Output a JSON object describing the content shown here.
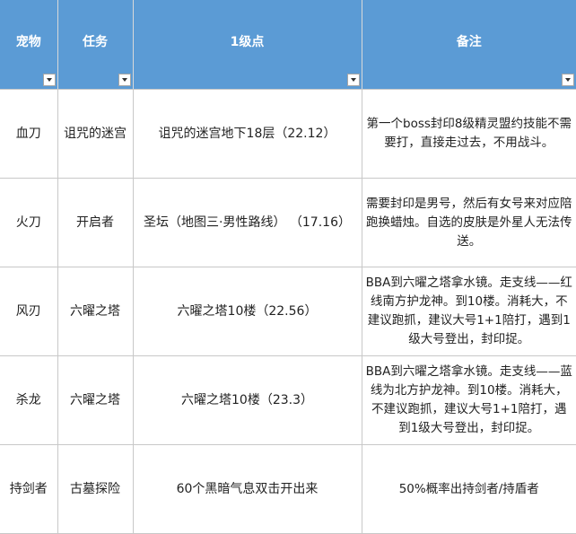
{
  "columns": [
    {
      "label": "宠物"
    },
    {
      "label": "任务"
    },
    {
      "label": "1级点"
    },
    {
      "label": "备注"
    }
  ],
  "rows": [
    {
      "pet": "血刀",
      "quest": "诅咒的迷宫",
      "spot": "诅咒的迷宫地下18层（22.12）",
      "note": "第一个boss封印8级精灵盟约技能不需要打，直接走过去，不用战斗。"
    },
    {
      "pet": "火刀",
      "quest": "开启者",
      "spot": "圣坛（地图三·男性路线） （17.16）",
      "note": "需要封印是男号，然后有女号来对应陪跑换蜡烛。自选的皮肤是外星人无法传送。"
    },
    {
      "pet": "风刃",
      "quest": "六曜之塔",
      "spot": "六曜之塔10楼（22.56）",
      "note": "BBA到六曜之塔拿水镜。走支线——红线南方护龙神。到10楼。消耗大，不建议跑抓，建议大号1+1陪打，遇到1级大号登出，封印捉。"
    },
    {
      "pet": "杀龙",
      "quest": "六曜之塔",
      "spot": "六曜之塔10楼（23.3）",
      "note": "BBA到六曜之塔拿水镜。走支线——蓝线为北方护龙神。到10楼。消耗大，不建议跑抓，建议大号1+1陪打，遇到1级大号登出，封印捉。"
    },
    {
      "pet": "持剑者",
      "quest": "古墓探险",
      "spot": "60个黑暗气息双击开出来",
      "note": "50%概率出持剑者/持盾者"
    }
  ]
}
